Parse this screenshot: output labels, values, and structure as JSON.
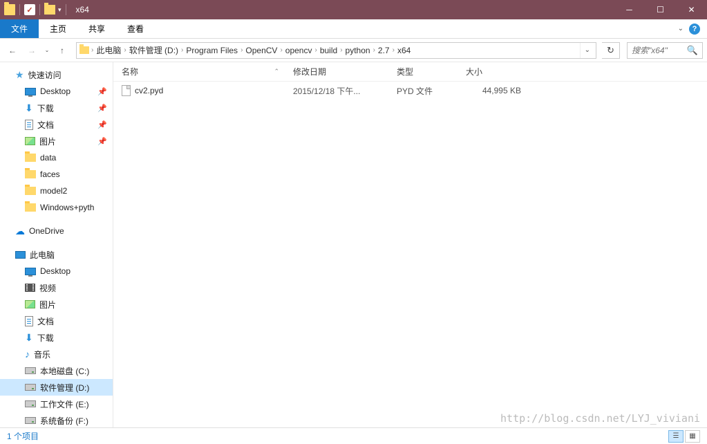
{
  "window": {
    "title": "x64"
  },
  "ribbon": {
    "file": "文件",
    "home": "主页",
    "share": "共享",
    "view": "查看"
  },
  "breadcrumbs": [
    "此电脑",
    "软件管理 (D:)",
    "Program Files",
    "OpenCV",
    "opencv",
    "build",
    "python",
    "2.7",
    "x64"
  ],
  "search": {
    "placeholder": "搜索\"x64\""
  },
  "sidebar": {
    "quick_access": "快速访问",
    "desktop": "Desktop",
    "downloads": "下载",
    "documents": "文档",
    "pictures": "图片",
    "data": "data",
    "faces": "faces",
    "model2": "model2",
    "winpy": "Windows+pyth",
    "onedrive": "OneDrive",
    "this_pc": "此电脑",
    "pc_desktop": "Desktop",
    "pc_videos": "视频",
    "pc_pictures": "图片",
    "pc_documents": "文档",
    "pc_downloads": "下载",
    "pc_music": "音乐",
    "drive_c": "本地磁盘 (C:)",
    "drive_d": "软件管理 (D:)",
    "drive_e": "工作文件 (E:)",
    "drive_f": "系统备份 (F:)"
  },
  "columns": {
    "name": "名称",
    "date": "修改日期",
    "type": "类型",
    "size": "大小"
  },
  "files": [
    {
      "name": "cv2.pyd",
      "date": "2015/12/18 下午...",
      "type": "PYD 文件",
      "size": "44,995 KB"
    }
  ],
  "status": {
    "count": "1 个项目"
  },
  "watermark": "http://blog.csdn.net/LYJ_viviani"
}
